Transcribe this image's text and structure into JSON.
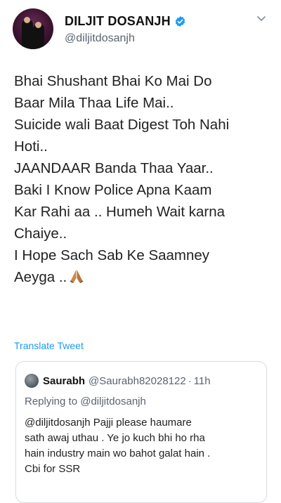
{
  "author": {
    "display_name": "DILJIT DOSANJH",
    "handle": "@diljitdosanjh"
  },
  "tweet": {
    "lines": [
      "Bhai Shushant Bhai Ko Mai Do",
      "Baar Mila Thaa Life Mai..",
      "Suicide wali Baat Digest Toh Nahi",
      "Hoti..",
      "JAANDAAR Banda Thaa Yaar..",
      "Baki I Know Police Apna Kaam",
      "Kar Rahi aa .. Humeh Wait karna",
      "Chaiye..",
      "I Hope Sach Sab Ke Saamney",
      "Aeyga .."
    ],
    "emoji": "folded-hands-emoji"
  },
  "translate_label": "Translate Tweet",
  "quoted_tweet": {
    "name": "Saurabh",
    "handle": "@Saurabh82028122",
    "separator": "·",
    "time": "11h",
    "replying_to_prefix": "Replying to ",
    "replying_to_handle": "@diljitdosanjh",
    "body_lines": [
      "@diljitdosanjh  Pajji  please haumare",
      "sath awaj uthau . Ye jo kuch bhi ho rha",
      "hain industry main wo bahot galat hain .",
      "Cbi for SSR"
    ]
  },
  "colors": {
    "verified_blue": "#1d9bf0",
    "link_blue": "#1d9bf0",
    "secondary_text": "#5b6470",
    "border": "#d6dce1"
  }
}
